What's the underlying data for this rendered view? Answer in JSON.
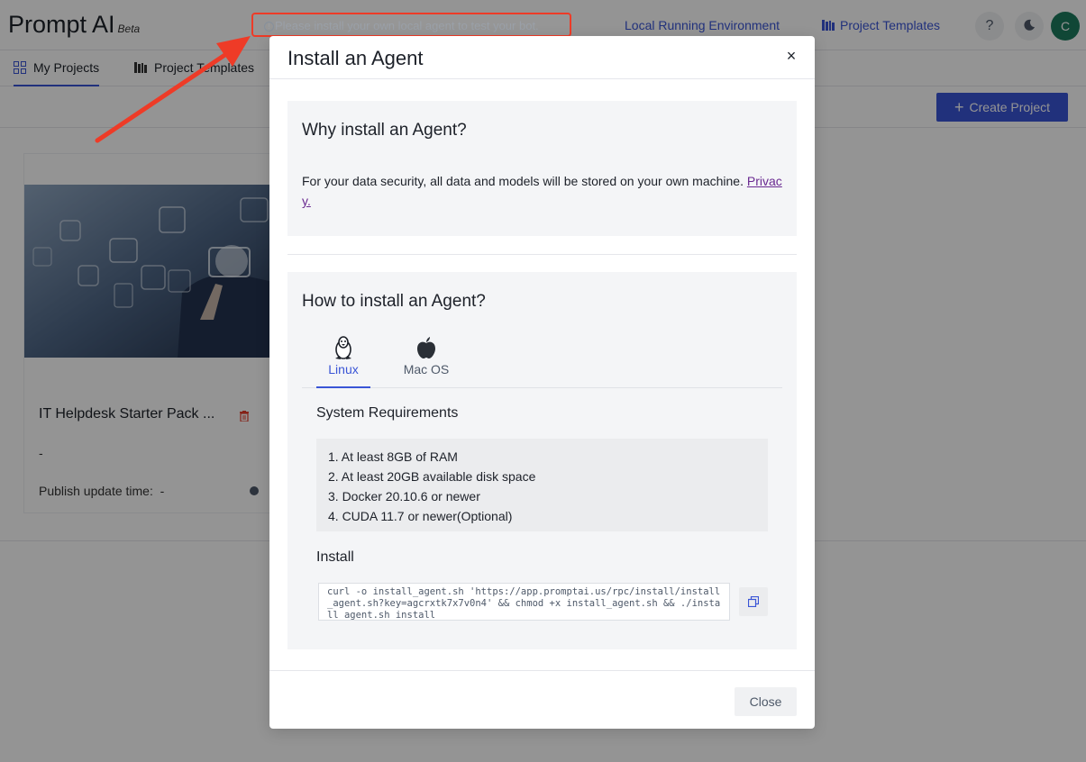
{
  "header": {
    "brand": "Prompt AI",
    "brand_badge": "Beta",
    "warning_text": "Please install your own local agent to test your bot.",
    "links": {
      "local_env": "Local Running Environment",
      "templates": "Project Templates"
    },
    "help_label": "?",
    "avatar_initial": "C"
  },
  "subnav": {
    "tabs": [
      {
        "label": "My Projects"
      },
      {
        "label": "Project Templates"
      }
    ]
  },
  "toolbar": {
    "create_label": "Create Project"
  },
  "project_card": {
    "title": "IT Helpdesk Starter Pack ...",
    "description": "-",
    "publish_label": "Publish update time:",
    "publish_value": "-"
  },
  "modal": {
    "title": "Install an Agent",
    "close_glyph": "×",
    "why": {
      "title": "Why install an Agent?",
      "text": "For your data security, all data and models will be stored on your own machine. ",
      "privacy_link": "Privacy."
    },
    "how": {
      "title": "How to install an Agent?",
      "tabs": [
        {
          "label": "Linux",
          "icon": "linux-icon",
          "selected": true
        },
        {
          "label": "Mac OS",
          "icon": "apple-icon",
          "selected": false
        }
      ],
      "requirements_title": "System Requirements",
      "requirements": [
        "1. At least 8GB of RAM",
        "2. At least 20GB available disk space",
        "3. Docker 20.10.6 or newer",
        "4. CUDA 11.7 or newer(Optional)"
      ],
      "install_title": "Install",
      "install_command": "curl -o install_agent.sh 'https://app.promptai.us/rpc/install/install_agent.sh?key=agcrxtk7x7v0n4' && chmod +x install_agent.sh && ./install_agent.sh install"
    },
    "footer": {
      "close_label": "Close"
    }
  },
  "colors": {
    "accent": "#3a55d6",
    "highlight": "#ee3b27",
    "avatar": "#1c7a5d"
  }
}
